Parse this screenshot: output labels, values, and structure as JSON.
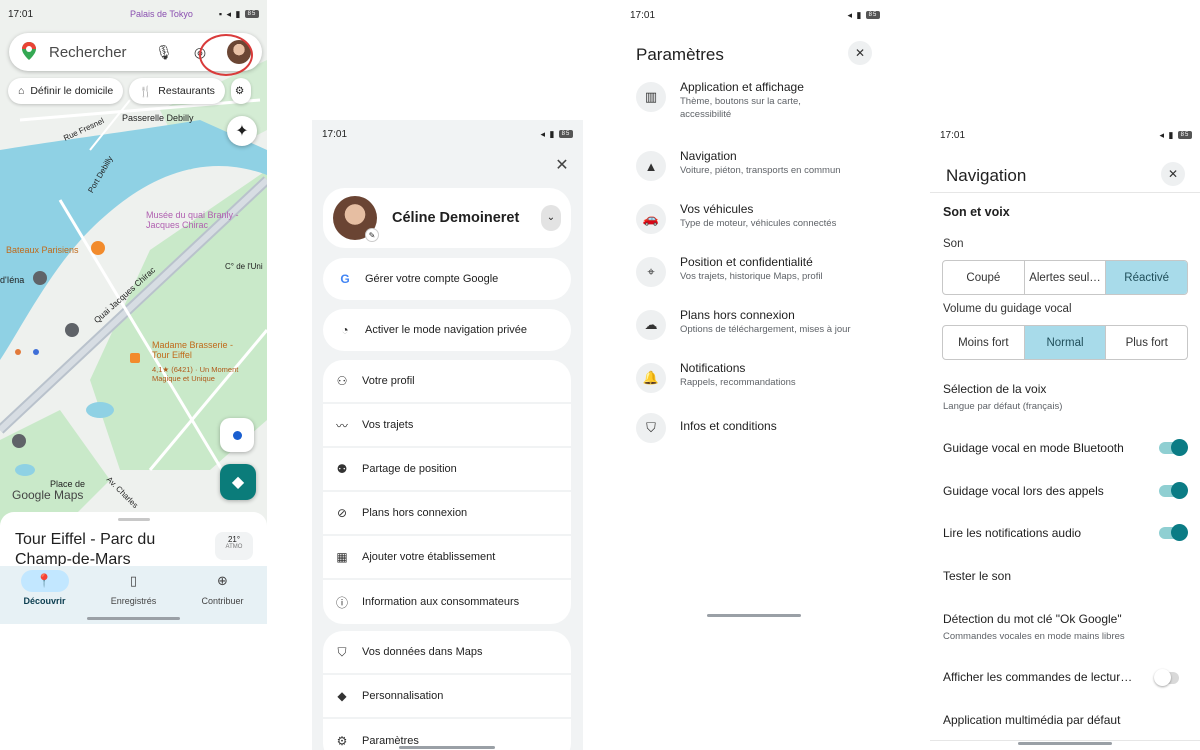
{
  "status": {
    "time": "17:01",
    "battery": "85"
  },
  "map_screen": {
    "search_placeholder": "Rechercher",
    "chips": [
      {
        "label": "Définir le domicile",
        "icon": "home-icon"
      },
      {
        "label": "Restaurants",
        "icon": "fork-knife-icon"
      }
    ],
    "map_labels": {
      "palais": "Palais de Tokyo",
      "passerelle": "Passerelle Debilly",
      "fresnel": "Rue Fresnel",
      "debilly": "Port Debilly",
      "musee": "Musée du quai Branly - Jacques Chirac",
      "bateaux": "Bateaux Parisiens",
      "iena": "d'Iéna",
      "quai": "Quai Jacques Chirac",
      "brasserie": "Madame Brasserie - Tour Eiffel",
      "brasserie_rating": "4,1★ (6421) · Un Moment Magique et Unique",
      "place": "Place de",
      "charles": "Av. Charles",
      "google_maps": "Google Maps",
      "weather_inline": "C° de l'Uni"
    },
    "place_title": "Tour Eiffel - Parc du Champ-de-Mars",
    "weather": {
      "temp": "21°",
      "aq": "ATMO"
    },
    "bottom_nav": [
      {
        "label": "Découvrir",
        "icon": "pin-icon",
        "active": true
      },
      {
        "label": "Enregistrés",
        "icon": "bookmark-icon",
        "active": false
      },
      {
        "label": "Contribuer",
        "icon": "plus-circle-icon",
        "active": false
      }
    ]
  },
  "account_menu": {
    "user_name": "Céline Demoineret",
    "manage_account": "Gérer votre compte Google",
    "incognito": "Activer le mode navigation privée",
    "group1": [
      {
        "label": "Votre profil",
        "icon": "person-icon"
      },
      {
        "label": "Vos trajets",
        "icon": "timeline-icon"
      },
      {
        "label": "Partage de position",
        "icon": "location-share-icon"
      },
      {
        "label": "Plans hors connexion",
        "icon": "offline-icon"
      },
      {
        "label": "Ajouter votre établissement",
        "icon": "storefront-icon"
      },
      {
        "label": "Information aux consommateurs",
        "icon": "info-icon"
      }
    ],
    "group2": [
      {
        "label": "Vos données dans Maps",
        "icon": "shield-icon"
      },
      {
        "label": "Personnalisation",
        "icon": "diamond-icon"
      },
      {
        "label": "Paramètres",
        "icon": "gear-icon"
      }
    ]
  },
  "settings": {
    "title": "Paramètres",
    "items": [
      {
        "title": "Application et affichage",
        "subtitle": "Thème, boutons sur la carte, accessibilité",
        "icon": "map-icon"
      },
      {
        "title": "Navigation",
        "subtitle": "Voiture, piéton, transports en commun",
        "icon": "navigation-arrow-icon"
      },
      {
        "title": "Vos véhicules",
        "subtitle": "Type de moteur, véhicules connectés",
        "icon": "car-icon"
      },
      {
        "title": "Position et confidentialité",
        "subtitle": "Vos trajets, historique Maps, profil",
        "icon": "location-pin-icon"
      },
      {
        "title": "Plans hors connexion",
        "subtitle": "Options de téléchargement, mises à jour",
        "icon": "cloud-off-icon"
      },
      {
        "title": "Notifications",
        "subtitle": "Rappels, recommandations",
        "icon": "bell-icon"
      },
      {
        "title": "Infos et conditions",
        "subtitle": "",
        "icon": "shield-info-icon"
      }
    ]
  },
  "navigation_settings": {
    "title": "Navigation",
    "section_sound": "Son et voix",
    "sound_label": "Son",
    "sound_options": [
      "Coupé",
      "Alertes seul…",
      "Réactivé"
    ],
    "sound_selected": "Réactivé",
    "volume_label": "Volume du guidage vocal",
    "volume_options": [
      "Moins fort",
      "Normal",
      "Plus fort"
    ],
    "volume_selected": "Normal",
    "voice_selection": "Sélection de la voix",
    "voice_selection_sub": "Langue par défaut (français)",
    "bluetooth": "Guidage vocal en mode Bluetooth",
    "bluetooth_on": true,
    "calls": "Guidage vocal lors des appels",
    "calls_on": true,
    "audio_notif": "Lire les notifications audio",
    "audio_notif_on": true,
    "test_sound": "Tester le son",
    "ok_google": "Détection du mot clé \"Ok Google\"",
    "ok_google_sub": "Commandes vocales en mode mains libres",
    "media_controls": "Afficher les commandes de lectur…",
    "media_controls_on": false,
    "default_media": "Application multimédia par défaut"
  }
}
